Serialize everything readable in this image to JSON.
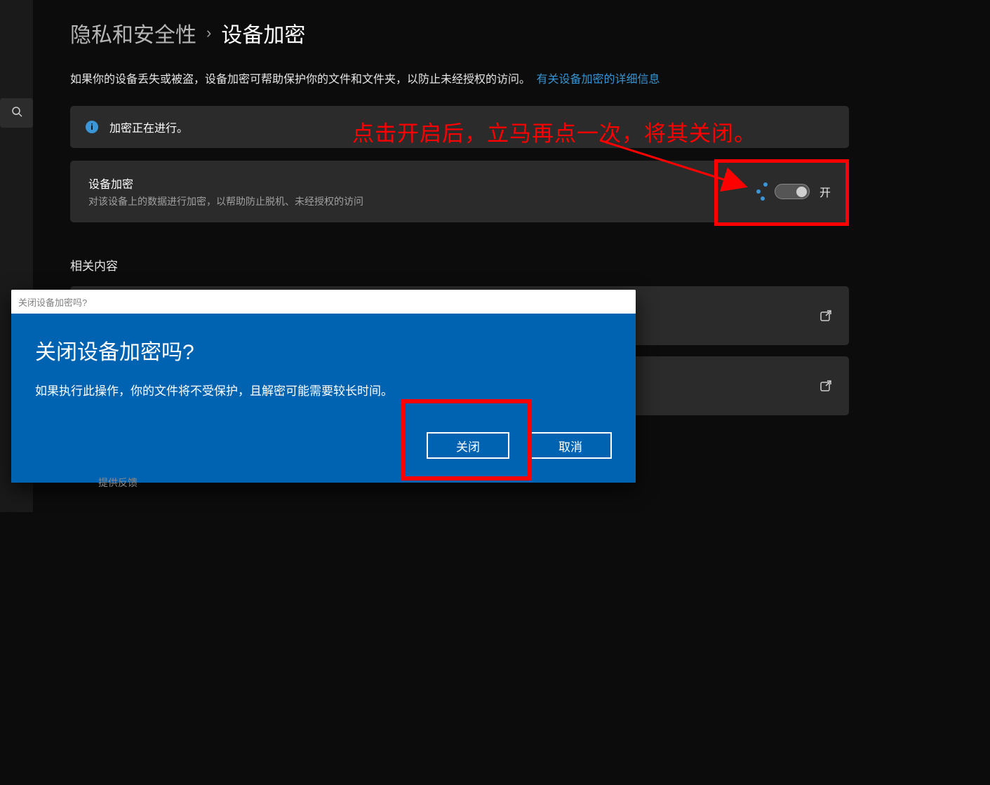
{
  "breadcrumb": {
    "parent": "隐私和安全性",
    "separator": "›",
    "current": "设备加密"
  },
  "description": {
    "text": "如果你的设备丢失或被盗，设备加密可帮助保护你的文件和文件夹，以防止未经授权的访问。",
    "link": "有关设备加密的详细信息"
  },
  "info_card": {
    "text": "加密正在进行。"
  },
  "setting_card": {
    "title": "设备加密",
    "subtitle": "对该设备上的数据进行加密，以帮助防止脱机、未经授权的访问",
    "toggle_label": "开"
  },
  "section_heading": "相关内容",
  "annotation": {
    "text": "点击开启后，立马再点一次，将其关闭。"
  },
  "dialog": {
    "titlebar": "关闭设备加密吗?",
    "heading": "关闭设备加密吗?",
    "body": "如果执行此操作，你的文件将不受保护，且解密可能需要较长时间。",
    "close_btn": "关闭",
    "cancel_btn": "取消"
  },
  "hidden_below": "提供反馈"
}
